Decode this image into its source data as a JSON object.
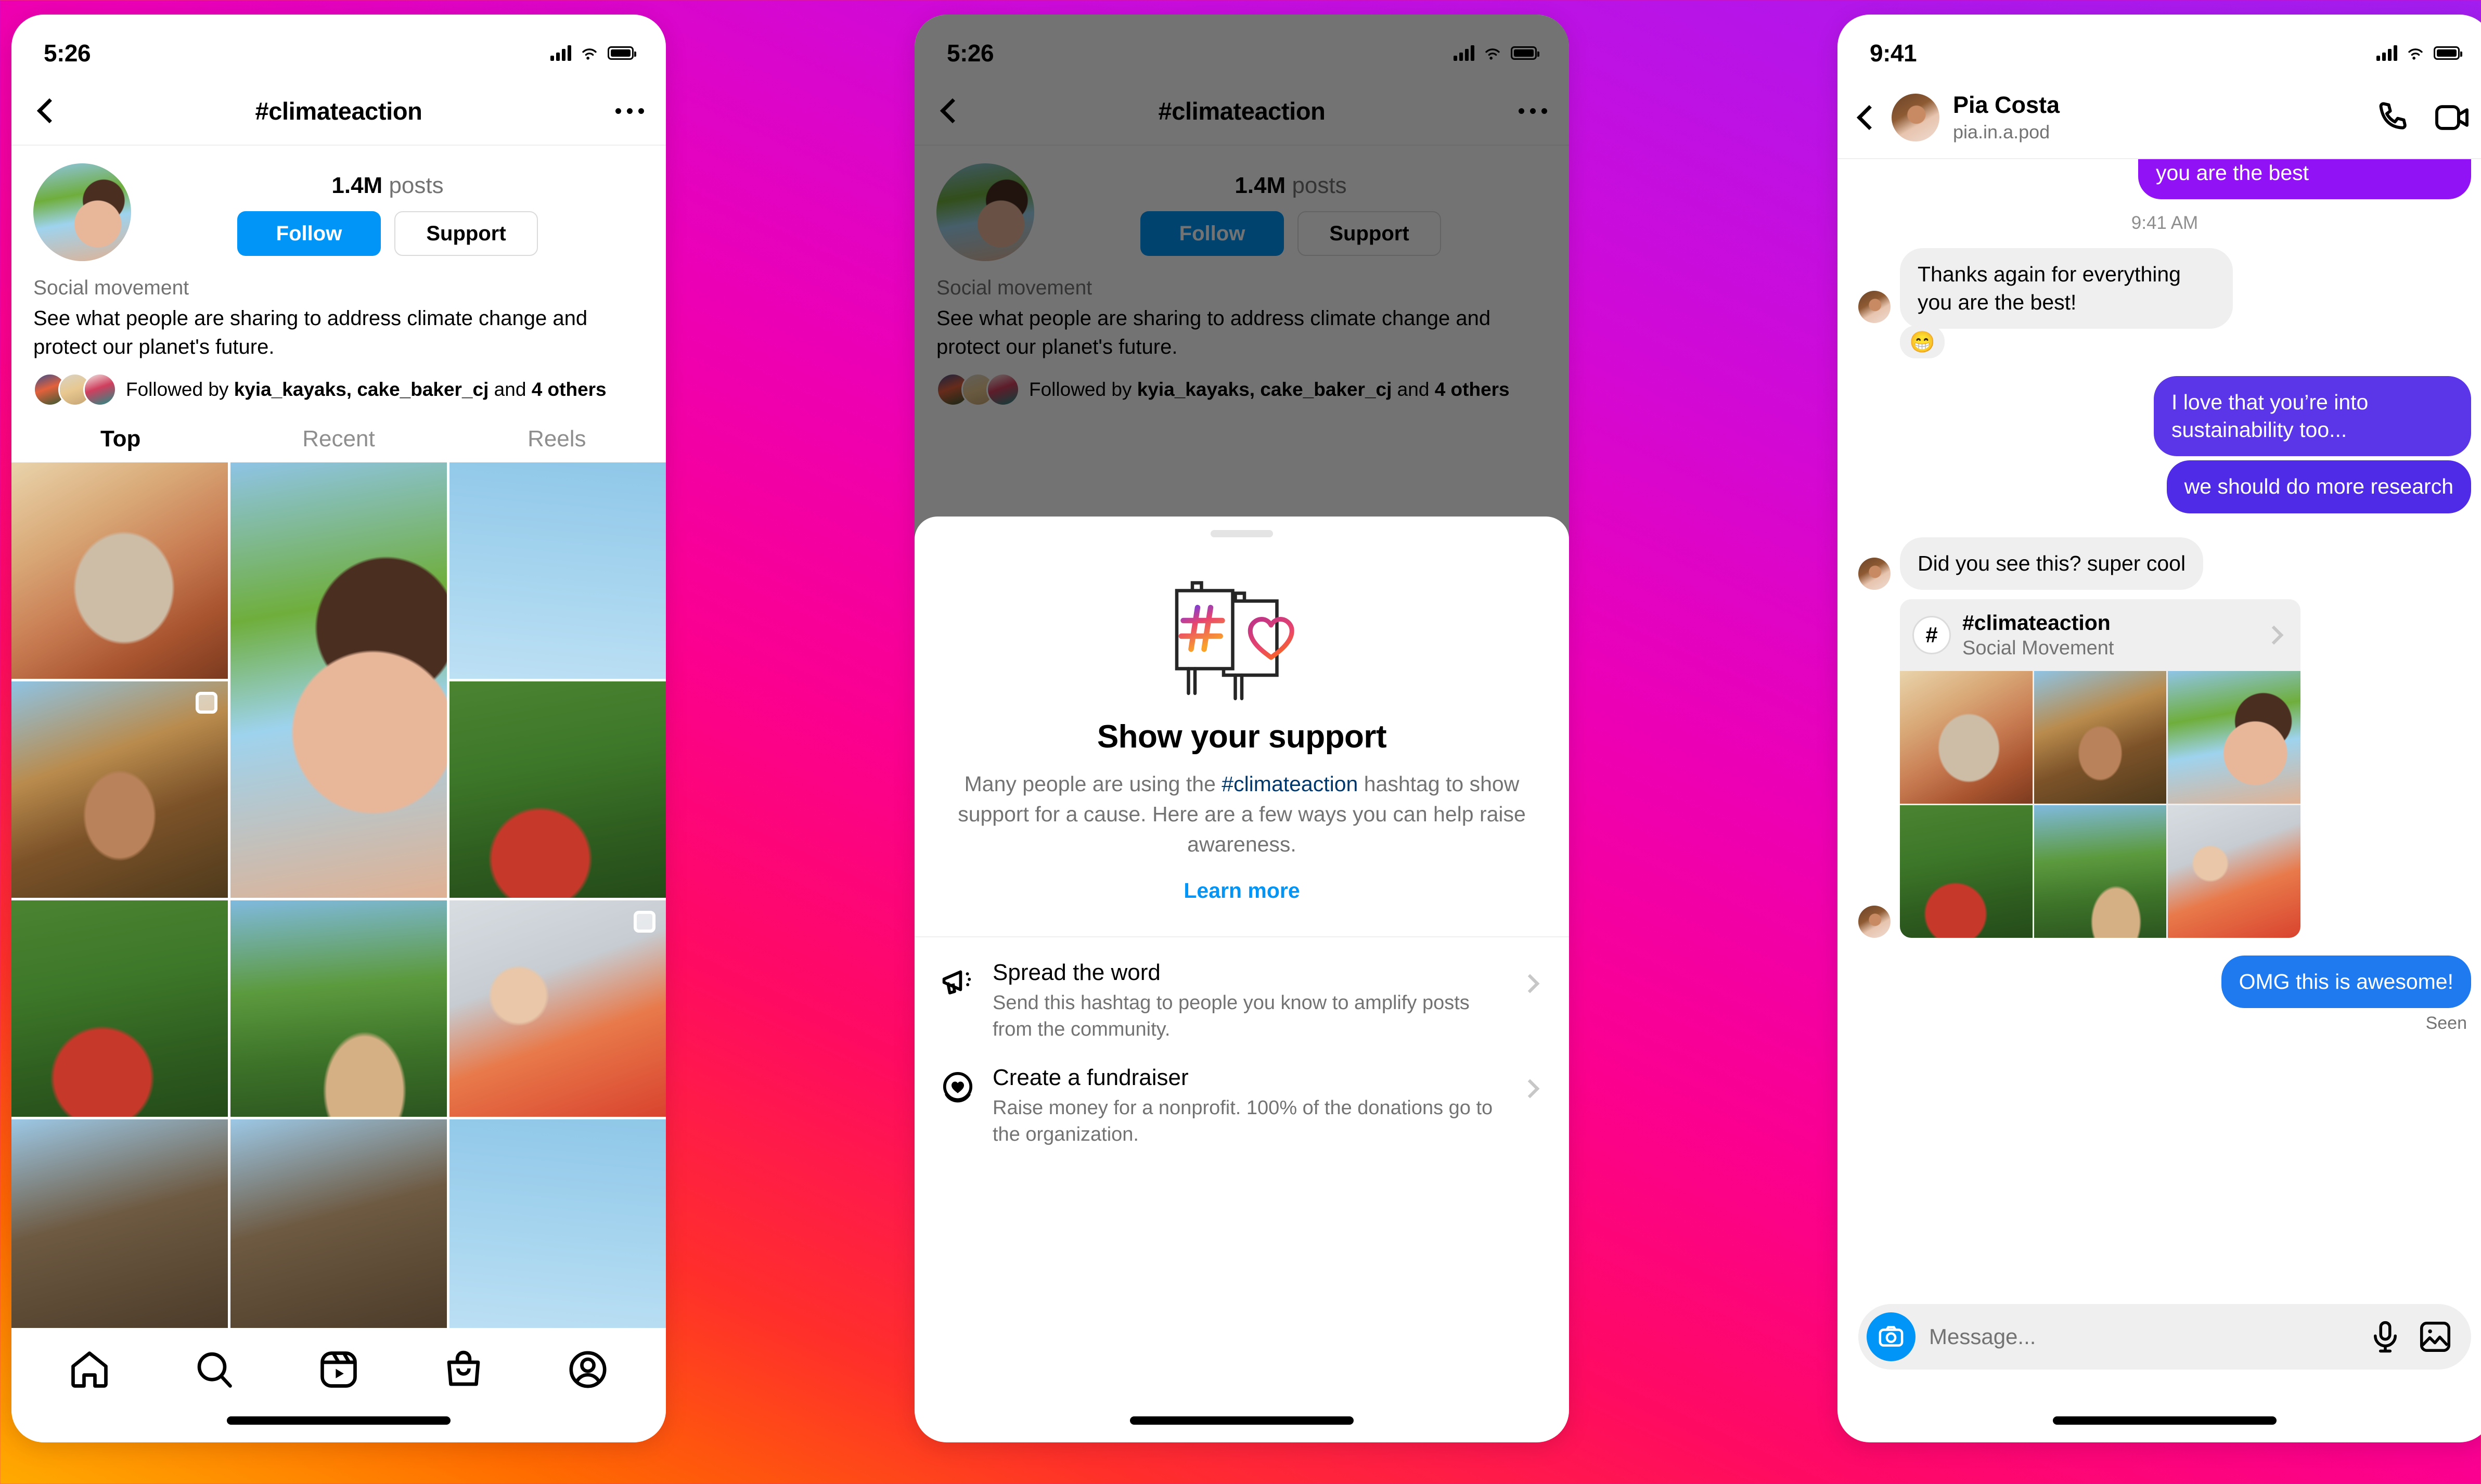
{
  "background": {
    "from": "#a21ef0",
    "mid": "#ff0a62",
    "to": "#ffab00"
  },
  "phone1": {
    "status": {
      "time": "5:26"
    },
    "nav": {
      "title": "#climateaction",
      "back_icon": "chevron-left-icon",
      "more_icon": "more-options-icon"
    },
    "profile": {
      "post_count": "1.4M",
      "post_label": "posts",
      "follow_button": "Follow",
      "support_button": "Support",
      "category": "Social movement",
      "description": "See what people are sharing to address climate change and protect our planet's future.",
      "followed_by_prefix": "Followed by ",
      "followed_by_names": "kyia_kayaks, cake_baker_cj",
      "followed_by_mid": " and ",
      "followed_by_others": "4 others"
    },
    "tabs": [
      {
        "label": "Top",
        "active": true
      },
      {
        "label": "Recent",
        "active": false
      },
      {
        "label": "Reels",
        "active": false
      }
    ],
    "tabbar": [
      "home-icon",
      "search-icon",
      "reels-icon",
      "shop-icon",
      "profile-icon"
    ]
  },
  "phone2": {
    "status": {
      "time": "5:26"
    },
    "nav": {
      "title": "#climateaction"
    },
    "profile": {
      "post_count": "1.4M",
      "post_label": "posts",
      "follow_button": "Follow",
      "support_button": "Support",
      "category": "Social movement",
      "description": "See what people are sharing to address climate change and protect our planet's future.",
      "followed_by_prefix": "Followed by ",
      "followed_by_names": "kyia_kayaks, cake_baker_cj",
      "followed_by_mid": " and ",
      "followed_by_others": "4 others"
    },
    "sheet": {
      "illustration": "hashtag-heart-signs-illustration",
      "heading": "Show your support",
      "body_pre": "Many people are using the ",
      "body_link": "#climateaction",
      "body_post": " hashtag to show support for a cause. Here are a few ways you can help raise awareness.",
      "learn_more": "Learn more",
      "actions": [
        {
          "icon": "megaphone-icon",
          "title": "Spread the word",
          "desc": "Send this hashtag to people you know to amplify posts from the community."
        },
        {
          "icon": "heart-circle-icon",
          "title": "Create a fundraiser",
          "desc": "Raise money for a nonprofit. 100% of the donations go to the organization."
        }
      ]
    }
  },
  "phone3": {
    "status": {
      "time": "9:41"
    },
    "nav": {
      "back_icon": "chevron-left-icon",
      "name": "Pia Costa",
      "handle": "pia.in.a.pod",
      "call_icon": "phone-call-icon",
      "video_icon": "video-call-icon"
    },
    "messages": [
      {
        "id": "m0",
        "side": "me",
        "style": "violet",
        "text": "you are the best",
        "partial": true
      },
      {
        "id": "ts",
        "type": "timestamp",
        "text": "9:41 AM"
      },
      {
        "id": "m1",
        "side": "them",
        "style": "grey",
        "text": "Thanks again for everything you are the best!",
        "reaction": "😁"
      },
      {
        "id": "m2",
        "side": "me",
        "style": "purple",
        "text": "I love that you’re into sustainability too..."
      },
      {
        "id": "m3",
        "side": "me",
        "style": "purple2",
        "text": "we should do more research"
      },
      {
        "id": "m4",
        "side": "them",
        "style": "grey",
        "text": "Did you see this? super cool"
      }
    ],
    "hashtag_card": {
      "avatar_glyph": "#",
      "title": "#climateaction",
      "subtitle": "Social Movement",
      "chevron_icon": "chevron-right-icon"
    },
    "last_message": {
      "text": "OMG this is awesome!",
      "style": "blue"
    },
    "seen_label": "Seen",
    "share_fab_icon": "share-paper-plane-icon",
    "composer": {
      "camera_icon": "camera-icon",
      "placeholder": "Message...",
      "mic_icon": "microphone-icon",
      "gallery_icon": "gallery-icon"
    }
  }
}
